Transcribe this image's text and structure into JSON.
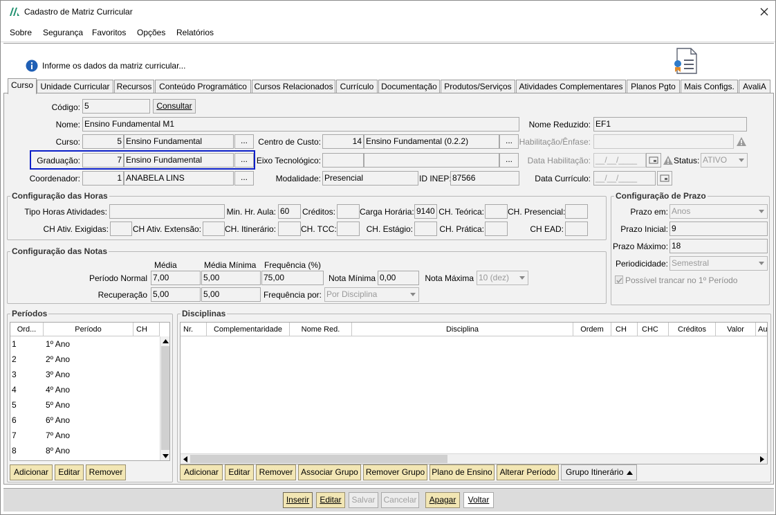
{
  "window": {
    "title": "Cadastro de Matriz Curricular",
    "close_icon": "close-icon",
    "logo_icon": "app-logo-icon"
  },
  "menu": [
    "Sobre",
    "Segurança",
    "Favoritos",
    "Opções",
    "Relatórios"
  ],
  "info": {
    "text": "Informe os dados da matriz curricular..."
  },
  "tabs": [
    "Curso",
    "Unidade Curricular",
    "Recursos",
    "Conteúdo Programático",
    "Cursos Relacionados",
    "Currículo",
    "Documentação",
    "Produtos/Serviços",
    "Atividades Complementares",
    "Planos Pgto",
    "Mais Configs.",
    "AvaliA"
  ],
  "form": {
    "codigo_label": "Código:",
    "codigo": "5",
    "consultar": "Consultar",
    "nome_label": "Nome:",
    "nome": "Ensino Fundamental M1",
    "nome_reduzido_label": "Nome Reduzido:",
    "nome_reduzido": "EF1",
    "curso_label": "Curso:",
    "curso_id": "5",
    "curso_nome": "Ensino Fundamental",
    "centro_custo_label": "Centro de Custo:",
    "centro_custo_id": "14",
    "centro_custo_nome": "Ensino Fundamental (0.2.2)",
    "habilitacao_label": "Habilitação/Ênfase:",
    "graduacao_label": "Graduação:",
    "graduacao_id": "7",
    "graduacao_nome": "Ensino Fundamental",
    "eixo_label": "Eixo Tecnológico:",
    "data_habilitacao_label": "Data Habilitação:",
    "data_placeholder": "__/__/____",
    "status_label": "Status:",
    "status": "ATIVO",
    "coordenador_label": "Coordenador:",
    "coordenador_id": "1",
    "coordenador_nome": "ANABELA LINS",
    "modalidade_label": "Modalidade:",
    "modalidade": "Presencial",
    "inep_label": "ID INEP:",
    "inep": "87566",
    "data_curriculo_label": "Data Currículo:",
    "dots": "..."
  },
  "horas": {
    "title": "Configuração das Horas",
    "tipo_label": "Tipo Horas Atividades:",
    "min_hr_label": "Min. Hr. Aula:",
    "min_hr": "60",
    "creditos_label": "Créditos:",
    "carga_label": "Carga Horária:",
    "carga": "9140",
    "ch_teorica_label": "CH. Teórica:",
    "ch_presencial_label": "CH. Presencial:",
    "ch_ativ_exig_label": "CH Ativ. Exigidas:",
    "ch_ativ_ext_label": "CH Ativ. Extensão:",
    "ch_itin_label": "CH. Itinerário:",
    "ch_tcc_label": "CH. TCC:",
    "ch_estagio_label": "CH. Estágio:",
    "ch_pratica_label": "CH. Prática:",
    "ch_ead_label": "CH EAD:"
  },
  "notas": {
    "title": "Configuração das Notas",
    "media_h": "Média",
    "media_min_h": "Média Mínima",
    "freq_h": "Frequência (%)",
    "periodo_normal_label": "Período Normal",
    "pn_media": "7,00",
    "pn_media_min": "5,00",
    "pn_freq": "75,00",
    "nota_min_label": "Nota Mínima",
    "nota_min": "0,00",
    "nota_max_label": "Nota Máxima",
    "nota_max": "10 (dez)",
    "recuperacao_label": "Recuperação",
    "rec_media": "5,00",
    "rec_media_min": "5,00",
    "freq_por_label": "Frequência por:",
    "freq_por": "Por Disciplina"
  },
  "prazo": {
    "title": "Configuração de Prazo",
    "prazo_em_label": "Prazo em:",
    "prazo_em": "Anos",
    "inicial_label": "Prazo Inicial:",
    "inicial": "9",
    "maximo_label": "Prazo Máximo:",
    "maximo": "18",
    "periodicidade_label": "Periodicidade:",
    "periodicidade": "Semestral",
    "trancar_label": "Possível trancar no 1º Período"
  },
  "periodos": {
    "title": "Períodos",
    "headers": [
      "Ord...",
      "Período",
      "CH"
    ],
    "rows": [
      [
        "1",
        "1º Ano"
      ],
      [
        "2",
        "2º Ano"
      ],
      [
        "3",
        "3º Ano"
      ],
      [
        "4",
        "4º Ano"
      ],
      [
        "5",
        "5º Ano"
      ],
      [
        "6",
        "6º Ano"
      ],
      [
        "7",
        "7º Ano"
      ],
      [
        "8",
        "8º Ano"
      ]
    ],
    "buttons": [
      "Adicionar",
      "Editar",
      "Remover"
    ]
  },
  "disciplinas": {
    "title": "Disciplinas",
    "headers": [
      "Nr.",
      "Complementaridade",
      "Nome Red.",
      "Disciplina",
      "Ordem",
      "CH",
      "CHC",
      "Créditos",
      "Valor",
      "Au"
    ],
    "buttons": [
      "Adicionar",
      "Editar",
      "Remover",
      "Associar Grupo",
      "Remover Grupo",
      "Plano de Ensino",
      "Alterar Período"
    ],
    "grupo_itinerario": "Grupo Itinerário"
  },
  "actions": [
    "Inserir",
    "Editar",
    "Salvar",
    "Cancelar",
    "Apagar",
    "Voltar"
  ],
  "colors": {
    "accent_blue": "#0a1fc9",
    "yellow_btn": "#f2e6b4",
    "panel": "#f2f2f2"
  }
}
